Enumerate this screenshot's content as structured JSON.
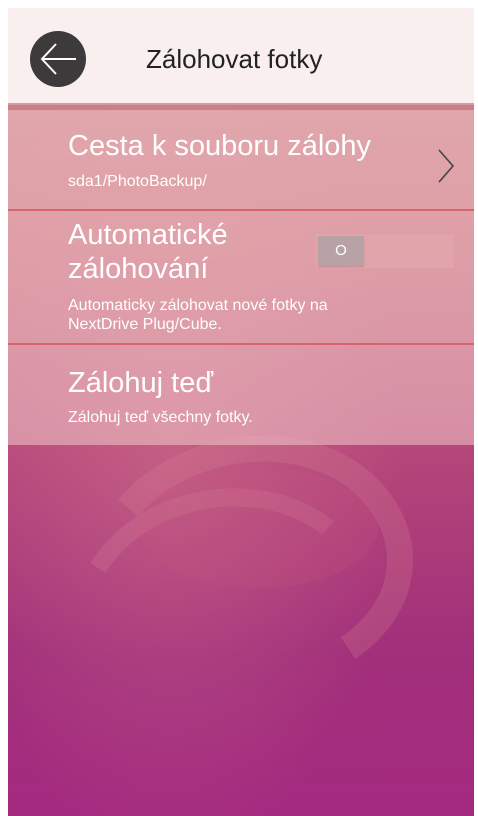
{
  "header": {
    "title": "Zálohovat fotky",
    "back_icon": "arrow-left-icon"
  },
  "settings": {
    "backup_path": {
      "title": "Cesta k souboru zálohy",
      "value": "sda1/PhotoBackup/",
      "icon": "chevron-right-icon"
    },
    "auto_backup": {
      "title_line1": "Automatické",
      "title_line2": "zálohování",
      "description_line1": "Automaticky zálohovat nové fotky na",
      "description_line2": "NextDrive Plug/Cube.",
      "toggle_label": "O",
      "enabled": false
    },
    "backup_now": {
      "title": "Zálohuj teď",
      "description": "Zálohuj teď všechny fotky."
    }
  },
  "colors": {
    "header_bg": "#f8efee",
    "divider": "#d7646c",
    "gradient_top": "#cf8a8c",
    "gradient_bottom": "#a42a80"
  }
}
